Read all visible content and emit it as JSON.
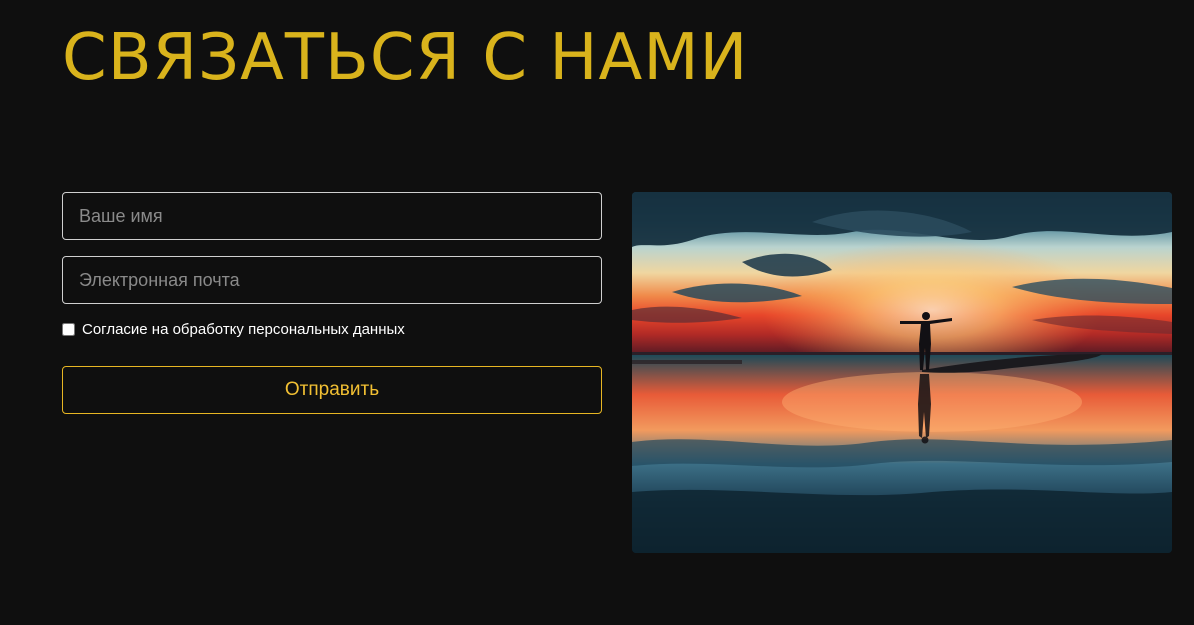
{
  "contact": {
    "title": "СВЯЗАТЬСЯ С НАМИ"
  },
  "form": {
    "name_placeholder": "Ваше имя",
    "email_placeholder": "Электронная почта",
    "consent_label": "Согласие на обработку персональных данных",
    "consent_checked": false,
    "submit_label": "Отправить"
  },
  "photo": {
    "subject": "silhouette-sunset-reflection"
  },
  "colors": {
    "background": "#0f0f0f",
    "title": "#d9b31c",
    "accent": "#e7b623",
    "field_border": "#cfcfcf"
  }
}
